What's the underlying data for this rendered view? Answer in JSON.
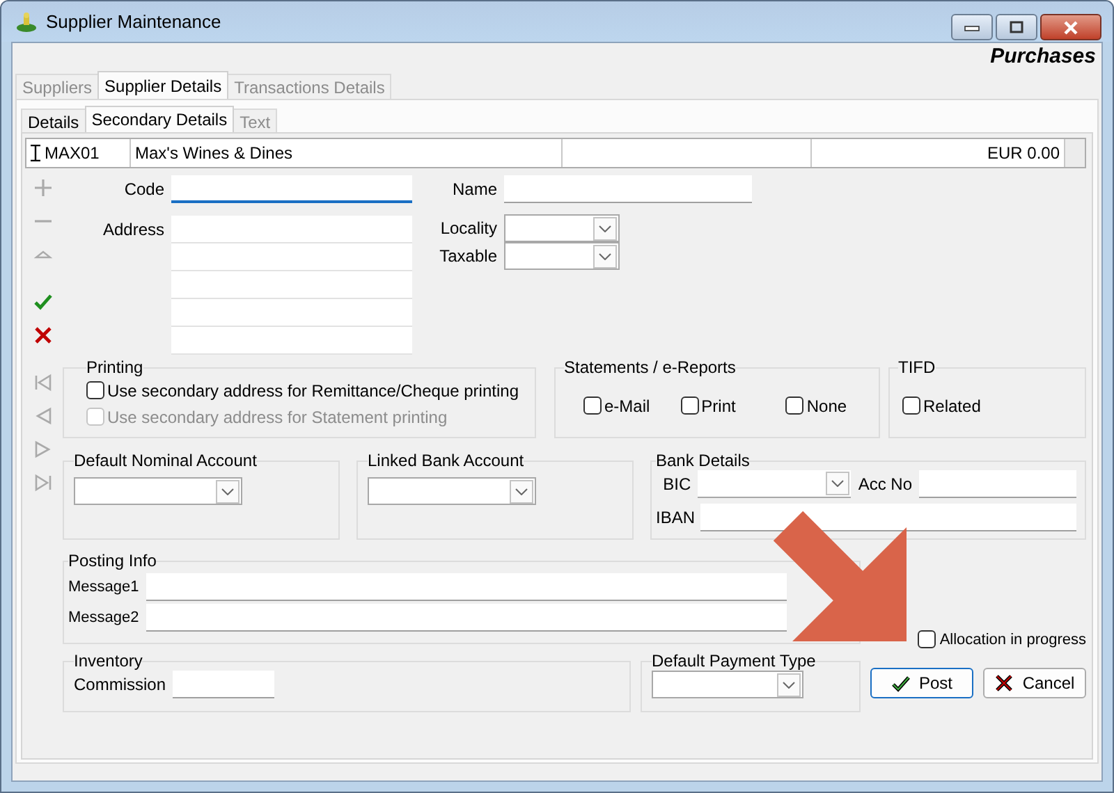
{
  "window": {
    "title": "Supplier Maintenance",
    "module": "Purchases"
  },
  "tabs": [
    {
      "label": "Suppliers",
      "selected": false,
      "disabled": true
    },
    {
      "label": "Supplier Details",
      "selected": true,
      "disabled": false
    },
    {
      "label": "Transactions Details",
      "selected": false,
      "disabled": true
    }
  ],
  "subtabs": [
    {
      "label": "Details",
      "selected": false,
      "disabled": false
    },
    {
      "label": "Secondary Details",
      "selected": true,
      "disabled": false
    },
    {
      "label": "Text",
      "selected": false,
      "disabled": true
    }
  ],
  "record": {
    "code": "MAX01",
    "name": "Max's Wines & Dines",
    "balance": "EUR 0.00"
  },
  "toolbar": [
    {
      "kind": "add",
      "disabled": true
    },
    {
      "kind": "remove",
      "disabled": true
    },
    {
      "kind": "up",
      "disabled": true
    },
    {
      "kind": "confirm",
      "disabled": false
    },
    {
      "kind": "cancel",
      "disabled": false
    },
    {
      "kind": "first",
      "disabled": true
    },
    {
      "kind": "prev",
      "disabled": true
    },
    {
      "kind": "next",
      "disabled": true
    },
    {
      "kind": "last",
      "disabled": true
    }
  ],
  "fields": {
    "code": {
      "label": "Code",
      "focused": true
    },
    "address": {
      "label": "Address"
    },
    "name": {
      "label": "Name"
    },
    "locality": {
      "label": "Locality"
    },
    "taxable": {
      "label": "Taxable"
    }
  },
  "printing": {
    "title": "Printing",
    "options": [
      {
        "label": "Use secondary address for Remittance/Cheque printing",
        "checked": false,
        "disabled": false
      },
      {
        "label": "Use secondary address for Statement printing",
        "checked": false,
        "disabled": true
      }
    ]
  },
  "statements": {
    "title": "Statements / e-Reports",
    "options": [
      {
        "label": "e-Mail",
        "checked": false
      },
      {
        "label": "Print",
        "checked": false
      },
      {
        "label": "None",
        "checked": false
      }
    ]
  },
  "tifd": {
    "title": "TIFD",
    "options": [
      {
        "label": "Related",
        "checked": false
      }
    ]
  },
  "nominal": {
    "title": "Default Nominal Account"
  },
  "linked_bank": {
    "title": "Linked Bank Account"
  },
  "bank_details": {
    "title": "Bank Details",
    "bic_label": "BIC",
    "acc_label": "Acc No",
    "iban_label": "IBAN"
  },
  "posting_info": {
    "title": "Posting Info",
    "fields": [
      "Message1",
      "Message2"
    ]
  },
  "inventory": {
    "title": "Inventory",
    "commission_label": "Commission"
  },
  "payment_type": {
    "title": "Default Payment Type"
  },
  "allocation": {
    "label": "Allocation in progress",
    "checked": false
  },
  "buttons": [
    {
      "label": "Post",
      "kind": "post",
      "default": true
    },
    {
      "label": "Cancel",
      "kind": "cancel",
      "default": false
    }
  ]
}
